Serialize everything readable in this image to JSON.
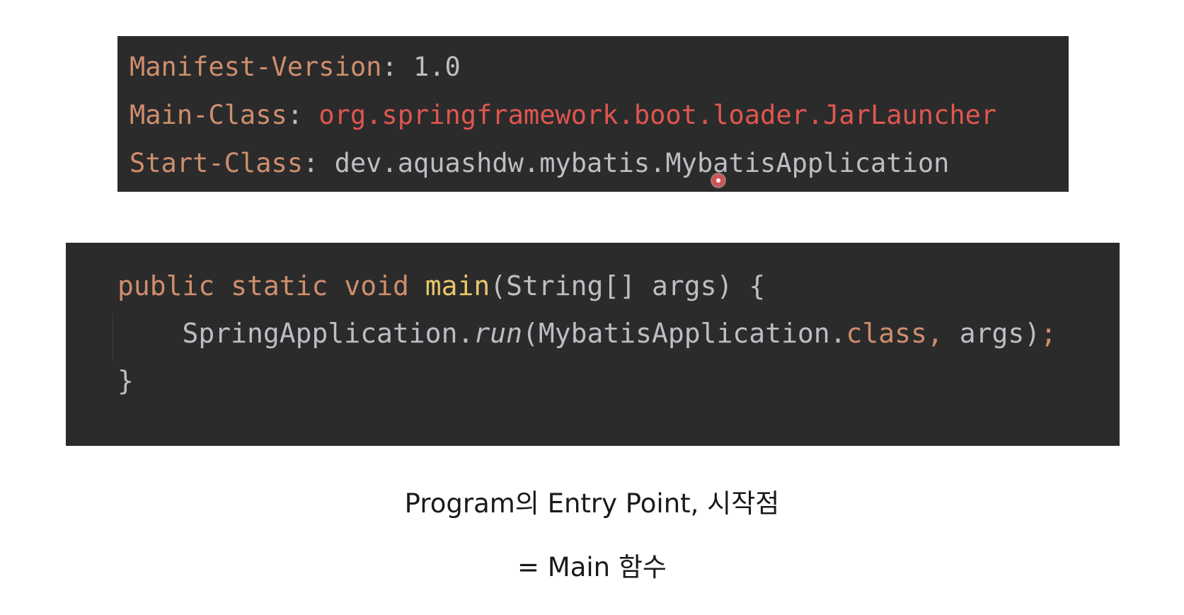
{
  "manifest": {
    "lines": [
      {
        "key": "Manifest-Version",
        "sep": ": ",
        "value": "1.0"
      },
      {
        "key": "Main-Class",
        "sep": ": ",
        "value": "org.springframework.boot.loader.JarLauncher"
      },
      {
        "key": "Start-Class",
        "sep": ": ",
        "value": "dev.aquashdw.mybatis.MybatisApplication"
      }
    ]
  },
  "code": {
    "line1": {
      "kw1": "public",
      "kw2": "static",
      "kw3": "void",
      "fn": "main",
      "rest": "(String[] args) {"
    },
    "line2": {
      "indent": "    ",
      "cls": "SpringApplication.",
      "method": "run",
      "open": "(MybatisApplication.",
      "kw": "class",
      "comma": ",",
      "args": " args)",
      "semi": ";"
    },
    "line3": {
      "close": "}"
    }
  },
  "captions": {
    "line1": "Program의 Entry Point, 시작점",
    "line2": "= Main 함수"
  },
  "colors": {
    "code_bg": "#2b2b2b",
    "keyword": "#cf8e6d",
    "function": "#e8c66a",
    "string_red": "#e0564f",
    "text": "#bcbec4"
  }
}
